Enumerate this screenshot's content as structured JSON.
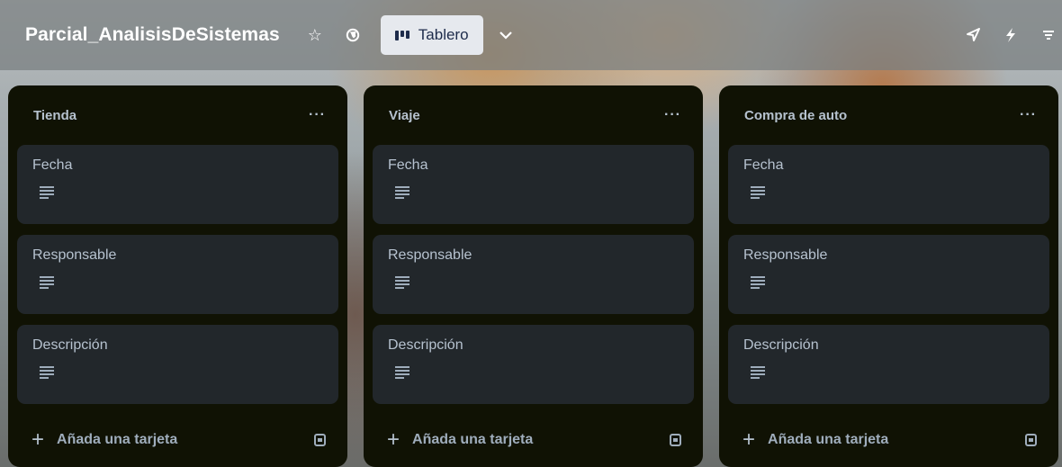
{
  "header": {
    "board_title": "Parcial_AnalisisDeSistemas",
    "view_button_label": "Tablero",
    "icons": [
      "star-icon",
      "globe-icon",
      "board-view-icon",
      "chevron-down-icon",
      "rocket-icon",
      "lightning-icon",
      "filter-icon"
    ]
  },
  "lists": [
    {
      "title": "Tienda",
      "menu": "···",
      "cards": [
        {
          "title": "Fecha"
        },
        {
          "title": "Responsable"
        },
        {
          "title": "Descripción"
        }
      ],
      "add_card_label": "Añada una tarjeta"
    },
    {
      "title": "Viaje",
      "menu": "···",
      "cards": [
        {
          "title": "Fecha"
        },
        {
          "title": "Responsable"
        },
        {
          "title": "Descripción"
        }
      ],
      "add_card_label": "Añada una tarjeta"
    },
    {
      "title": "Compra de auto",
      "menu": "···",
      "cards": [
        {
          "title": "Fecha"
        },
        {
          "title": "Responsable"
        },
        {
          "title": "Descripción"
        }
      ],
      "add_card_label": "Añada una tarjeta"
    }
  ],
  "colors": {
    "list_bg": "#101204",
    "card_bg": "#22272b",
    "text": "#b6c2cf",
    "view_button_bg": "#e6e9ee"
  }
}
